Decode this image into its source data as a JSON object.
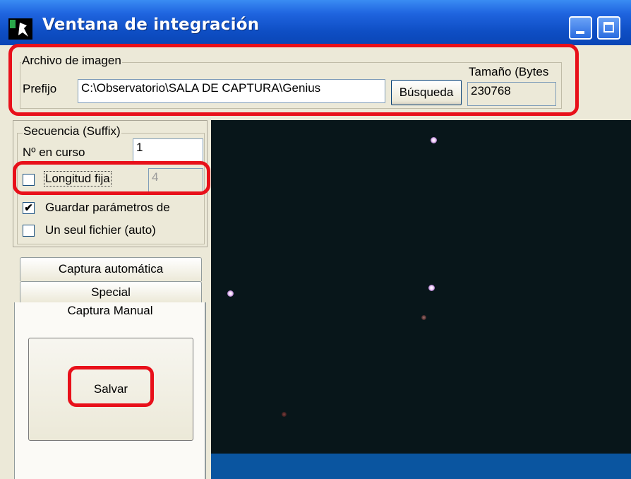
{
  "window": {
    "title": "Ventana de integración",
    "buttons": [
      "minimize",
      "maximize"
    ]
  },
  "image_file": {
    "group_title": "Archivo de imagen",
    "prefix_label": "Prefijo",
    "prefix_value": "C:\\Observatorio\\SALA DE CAPTURA\\Genius",
    "browse_label": "Búsqueda",
    "size_label": "Tamaño (Bytes",
    "size_value": "230768"
  },
  "sequence": {
    "group_title": "Secuencia (Suffix)",
    "current_label": "Nº en curso",
    "current_value": "1",
    "fixed_length_label": "Longitud fija",
    "fixed_length_value": "4",
    "fixed_length_checked": false,
    "save_params_label": "Guardar parámetros de",
    "save_params_checked": true,
    "single_file_label": "Un seul fichier (auto)",
    "single_file_checked": false
  },
  "tabs": {
    "auto": "Captura automática",
    "special": "Special",
    "manual": "Captura Manual"
  },
  "manual": {
    "save_label": "Salvar"
  },
  "colors": {
    "highlight": "#e8101a",
    "image_bg": "#08161a",
    "titlebar": "#0e4ec4"
  }
}
